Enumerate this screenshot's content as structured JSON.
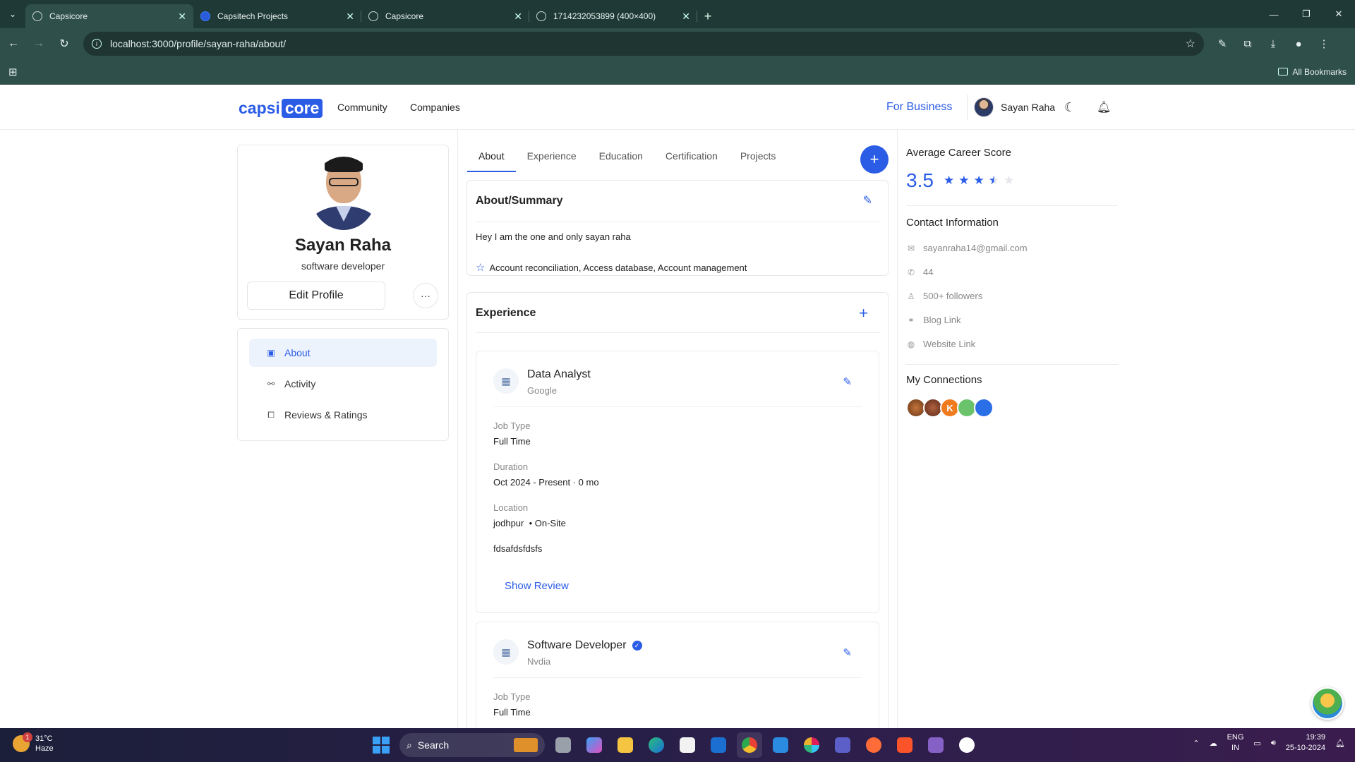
{
  "browser": {
    "tabs": [
      {
        "title": "Capsicore",
        "active": true
      },
      {
        "title": "Capsitech Projects",
        "active": false
      },
      {
        "title": "Capsicore",
        "active": false
      },
      {
        "title": "1714232053899 (400×400)",
        "active": false
      }
    ],
    "url": "localhost:3000/profile/sayan-raha/about/",
    "all_bookmarks": "All Bookmarks"
  },
  "header": {
    "logo_part1": "capsi",
    "logo_part2": "core",
    "nav": [
      "Community",
      "Companies"
    ],
    "for_business": "For Business",
    "user_name": "Sayan Raha"
  },
  "profile": {
    "name": "Sayan Raha",
    "role": "software developer",
    "edit_label": "Edit Profile",
    "more_label": "···"
  },
  "side_menu": [
    "About",
    "Activity",
    "Reviews & Ratings"
  ],
  "tabs": [
    "About",
    "Experience",
    "Education",
    "Certification",
    "Projects"
  ],
  "fab_label": "+",
  "about": {
    "title": "About/Summary",
    "text": "Hey I am the one and only sayan raha",
    "skills": "Account reconciliation, Access database, Account management"
  },
  "experience": {
    "title": "Experience",
    "jobs": [
      {
        "title": "Data Analyst",
        "company": "Google",
        "job_type_label": "Job Type",
        "job_type": "Full Time",
        "duration_label": "Duration",
        "duration": "Oct 2024 - Present · 0 mo",
        "location_label": "Location",
        "location": "jodhpur  • On-Site",
        "description": "fdsafdsfdsfs",
        "show_review": "Show Review"
      },
      {
        "title": "Software Developer",
        "company": "Nvdia",
        "job_type_label": "Job Type",
        "job_type": "Full Time"
      }
    ]
  },
  "right": {
    "score_title": "Average Career Score",
    "score": "3.5",
    "rating": 3.5,
    "contact_title": "Contact Information",
    "contacts": [
      "sayanraha14@gmail.com",
      "44",
      "500+ followers",
      "Blog Link",
      "Website Link"
    ],
    "connections_title": "My Connections",
    "connections": [
      "",
      "",
      "K",
      "",
      ""
    ]
  },
  "taskbar": {
    "temp": "31°C",
    "weather": "Haze",
    "badge": "1",
    "search": "Search",
    "lang1": "ENG",
    "lang2": "IN",
    "time": "19:39",
    "date": "25-10-2024"
  },
  "colors": {
    "accent": "#2b5ce6",
    "chrome": "#2f4f4a"
  }
}
